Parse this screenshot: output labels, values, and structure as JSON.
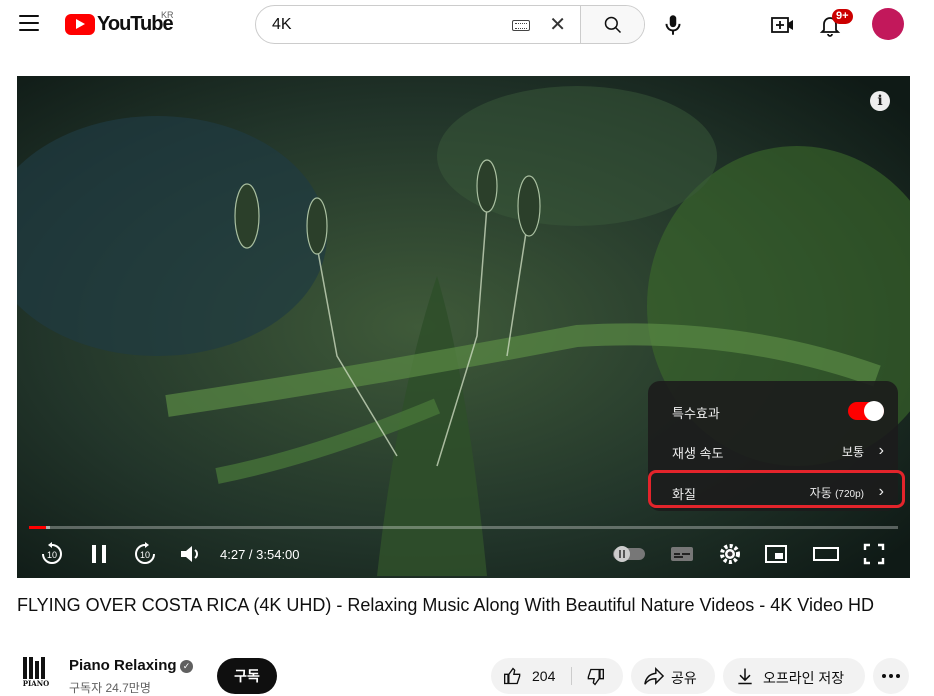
{
  "header": {
    "logo_text": "YouTube",
    "country_code": "KR",
    "search_value": "4K",
    "notification_count": "9+",
    "icons": [
      "menu-icon",
      "keyboard-icon",
      "clear-icon",
      "search-icon",
      "mic-icon",
      "create-icon",
      "bell-icon"
    ]
  },
  "player": {
    "settings_menu": {
      "effects_label": "특수효과",
      "effects_on": true,
      "speed_label": "재생 속도",
      "speed_value": "보통",
      "quality_label": "화질",
      "quality_value": "자동",
      "quality_detail": "(720p)"
    },
    "time_display": "4:27 / 3:54:00",
    "progress_fraction": 0.019,
    "buffered_fraction": 0.024,
    "colors": {
      "accent": "#ff0000",
      "highlight": "#e3242b"
    }
  },
  "video": {
    "title": "FLYING OVER COSTA RICA (4K UHD) - Relaxing Music Along With Beautiful Nature Videos - 4K Video HD",
    "channel_name": "Piano Relaxing",
    "subscribers": "구독자 24.7만명",
    "subscribe_label": "구독",
    "like_count": "204",
    "share_label": "공유",
    "offline_label": "오프라인 저장"
  }
}
